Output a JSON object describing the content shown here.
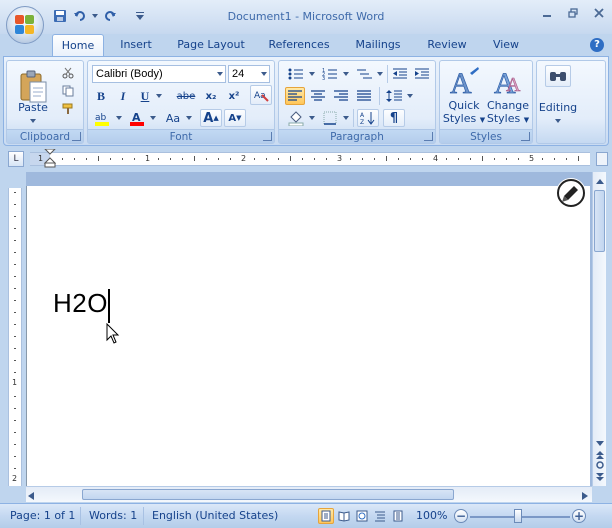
{
  "window": {
    "title": "Document1 - Microsoft Word",
    "controls": [
      "minimize-icon",
      "restore-icon",
      "close-icon"
    ]
  },
  "quick_access": [
    "save-icon",
    "undo-icon",
    "redo-icon",
    "customize-qat-icon"
  ],
  "tabs": [
    {
      "label": "Home",
      "active": true
    },
    {
      "label": "Insert"
    },
    {
      "label": "Page Layout"
    },
    {
      "label": "References"
    },
    {
      "label": "Mailings"
    },
    {
      "label": "Review"
    },
    {
      "label": "View"
    }
  ],
  "ribbon": {
    "clipboard": {
      "label": "Clipboard",
      "paste_label": "Paste"
    },
    "font": {
      "label": "Font",
      "font_name": "Calibri (Body)",
      "font_size": "24",
      "bold": "B",
      "italic": "I",
      "underline": "U",
      "strikethrough": "abe",
      "subscript": "x₂",
      "superscript": "x²",
      "change_case": "Aa",
      "grow": "A",
      "shrink": "A"
    },
    "paragraph": {
      "label": "Paragraph",
      "show_marks": "¶"
    },
    "styles": {
      "label": "Styles",
      "quick_styles": "Quick\nStyles",
      "quick_styles_1": "Quick",
      "quick_styles_2": "Styles",
      "change_styles_1": "Change",
      "change_styles_2": "Styles"
    },
    "editing": {
      "label": "Editing"
    }
  },
  "ruler": {
    "numbers": [
      "1",
      "1",
      "2",
      "3",
      "4",
      "5"
    ],
    "vnumbers": [
      "1",
      "2"
    ]
  },
  "document": {
    "text": "H2O"
  },
  "status": {
    "page": "Page: 1 of 1",
    "words": "Words: 1",
    "language": "English (United States)",
    "zoom": "100%",
    "zoom_out": "−",
    "zoom_in": "+"
  },
  "colors": {
    "accent": "#15428b",
    "highlight": "#ffff00",
    "font_color": "#ff0000",
    "active_button": "#ffc65a"
  }
}
